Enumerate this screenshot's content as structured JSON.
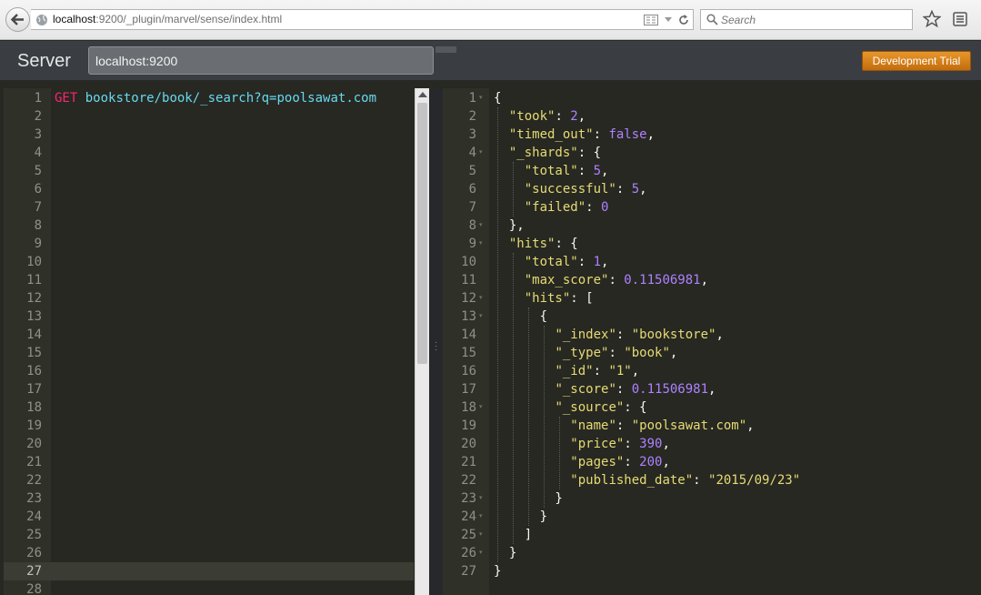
{
  "browser": {
    "url_host": "localhost",
    "url_rest": ":9200/_plugin/marvel/sense/index.html",
    "search_placeholder": "Search"
  },
  "header": {
    "server_label": "Server",
    "server_value": "localhost:9200",
    "dev_trial_label": "Development Trial"
  },
  "request": {
    "line_numbers": [
      "1",
      "2",
      "3",
      "4",
      "5",
      "6",
      "7",
      "8",
      "9",
      "10",
      "11",
      "12",
      "13",
      "14",
      "15",
      "16",
      "17",
      "18",
      "19",
      "20",
      "21",
      "22",
      "23",
      "24",
      "25",
      "26",
      "27",
      "28"
    ],
    "method": "GET",
    "path": "bookstore/book/_search",
    "query": "?q=poolsawat.com"
  },
  "response": {
    "line_numbers": [
      "1",
      "2",
      "3",
      "4",
      "5",
      "6",
      "7",
      "8",
      "9",
      "10",
      "11",
      "12",
      "13",
      "14",
      "15",
      "16",
      "17",
      "18",
      "19",
      "20",
      "21",
      "22",
      "23",
      "24",
      "25",
      "26",
      "27"
    ],
    "lines": [
      [
        [
          "pun",
          "{"
        ]
      ],
      [
        [
          "pun",
          "  "
        ],
        [
          "key",
          "\"took\""
        ],
        [
          "pun",
          ": "
        ],
        [
          "num",
          "2"
        ],
        [
          "pun",
          ","
        ]
      ],
      [
        [
          "pun",
          "  "
        ],
        [
          "key",
          "\"timed_out\""
        ],
        [
          "pun",
          ": "
        ],
        [
          "num",
          "false"
        ],
        [
          "pun",
          ","
        ]
      ],
      [
        [
          "pun",
          "  "
        ],
        [
          "key",
          "\"_shards\""
        ],
        [
          "pun",
          ": {"
        ]
      ],
      [
        [
          "pun",
          "    "
        ],
        [
          "key",
          "\"total\""
        ],
        [
          "pun",
          ": "
        ],
        [
          "num",
          "5"
        ],
        [
          "pun",
          ","
        ]
      ],
      [
        [
          "pun",
          "    "
        ],
        [
          "key",
          "\"successful\""
        ],
        [
          "pun",
          ": "
        ],
        [
          "num",
          "5"
        ],
        [
          "pun",
          ","
        ]
      ],
      [
        [
          "pun",
          "    "
        ],
        [
          "key",
          "\"failed\""
        ],
        [
          "pun",
          ": "
        ],
        [
          "num",
          "0"
        ]
      ],
      [
        [
          "pun",
          "  },"
        ]
      ],
      [
        [
          "pun",
          "  "
        ],
        [
          "key",
          "\"hits\""
        ],
        [
          "pun",
          ": {"
        ]
      ],
      [
        [
          "pun",
          "    "
        ],
        [
          "key",
          "\"total\""
        ],
        [
          "pun",
          ": "
        ],
        [
          "num",
          "1"
        ],
        [
          "pun",
          ","
        ]
      ],
      [
        [
          "pun",
          "    "
        ],
        [
          "key",
          "\"max_score\""
        ],
        [
          "pun",
          ": "
        ],
        [
          "num",
          "0.11506981"
        ],
        [
          "pun",
          ","
        ]
      ],
      [
        [
          "pun",
          "    "
        ],
        [
          "key",
          "\"hits\""
        ],
        [
          "pun",
          ": ["
        ]
      ],
      [
        [
          "pun",
          "      {"
        ]
      ],
      [
        [
          "pun",
          "        "
        ],
        [
          "key",
          "\"_index\""
        ],
        [
          "pun",
          ": "
        ],
        [
          "str",
          "\"bookstore\""
        ],
        [
          "pun",
          ","
        ]
      ],
      [
        [
          "pun",
          "        "
        ],
        [
          "key",
          "\"_type\""
        ],
        [
          "pun",
          ": "
        ],
        [
          "str",
          "\"book\""
        ],
        [
          "pun",
          ","
        ]
      ],
      [
        [
          "pun",
          "        "
        ],
        [
          "key",
          "\"_id\""
        ],
        [
          "pun",
          ": "
        ],
        [
          "str",
          "\"1\""
        ],
        [
          "pun",
          ","
        ]
      ],
      [
        [
          "pun",
          "        "
        ],
        [
          "key",
          "\"_score\""
        ],
        [
          "pun",
          ": "
        ],
        [
          "num",
          "0.11506981"
        ],
        [
          "pun",
          ","
        ]
      ],
      [
        [
          "pun",
          "        "
        ],
        [
          "key",
          "\"_source\""
        ],
        [
          "pun",
          ": {"
        ]
      ],
      [
        [
          "pun",
          "          "
        ],
        [
          "key",
          "\"name\""
        ],
        [
          "pun",
          ": "
        ],
        [
          "str",
          "\"poolsawat.com\""
        ],
        [
          "pun",
          ","
        ]
      ],
      [
        [
          "pun",
          "          "
        ],
        [
          "key",
          "\"price\""
        ],
        [
          "pun",
          ": "
        ],
        [
          "num",
          "390"
        ],
        [
          "pun",
          ","
        ]
      ],
      [
        [
          "pun",
          "          "
        ],
        [
          "key",
          "\"pages\""
        ],
        [
          "pun",
          ": "
        ],
        [
          "num",
          "200"
        ],
        [
          "pun",
          ","
        ]
      ],
      [
        [
          "pun",
          "          "
        ],
        [
          "key",
          "\"published_date\""
        ],
        [
          "pun",
          ": "
        ],
        [
          "str",
          "\"2015/09/23\""
        ]
      ],
      [
        [
          "pun",
          "        }"
        ]
      ],
      [
        [
          "pun",
          "      }"
        ]
      ],
      [
        [
          "pun",
          "    ]"
        ]
      ],
      [
        [
          "pun",
          "  }"
        ]
      ],
      [
        [
          "pun",
          "}"
        ]
      ]
    ]
  },
  "colors": {
    "editor_bg": "#272822",
    "keyword": "#f92672",
    "url": "#66d9ef",
    "string": "#e6db74",
    "number": "#ae81ff",
    "accent_button": "#e08a1e"
  }
}
